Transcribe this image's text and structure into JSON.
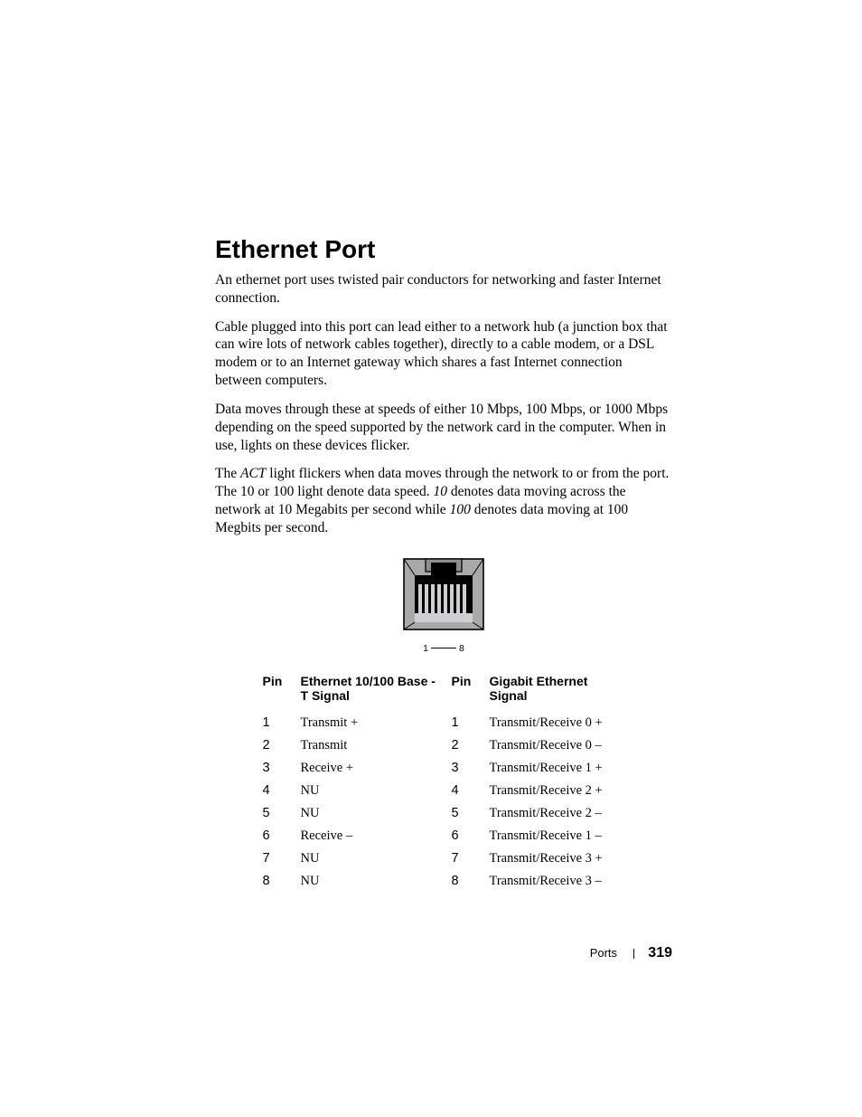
{
  "heading": "Ethernet Port",
  "para1": "An ethernet port uses twisted pair conductors for networking and faster Internet connection.",
  "para2": "Cable plugged into this port can lead either to a network hub (a junction box that can wire lots of network cables together), directly to a cable modem, or a DSL modem or to an Internet gateway which shares a fast Internet connection between computers.",
  "para3": "Data moves through these at speeds of either 10 Mbps, 100 Mbps, or 1000 Mbps depending on the speed supported by the network card in the computer. When in use, lights on these devices flicker.",
  "p4": {
    "a": "The ",
    "act": "ACT",
    "b": " light flickers when data moves through the network to or from the port. The 10 or 100 light denote data speed. ",
    "ten": "10",
    "c": " denotes data moving across the network at 10 Megabits per second while ",
    "hundred": "100",
    "d": " denotes data moving at 100 Megbits per second."
  },
  "caption": {
    "left": "1",
    "right": "8"
  },
  "headers": {
    "pin_a": "Pin",
    "signal_a": "Ethernet 10/100 Base - T Signal",
    "pin_b": "Pin",
    "signal_b": "Gigabit Ethernet Signal"
  },
  "rows": [
    {
      "pa": "1",
      "sa": "Transmit +",
      "pb": "1",
      "sb": "Transmit/Receive 0 +"
    },
    {
      "pa": "2",
      "sa": "Transmit",
      "pb": "2",
      "sb": "Transmit/Receive 0 –"
    },
    {
      "pa": "3",
      "sa": "Receive +",
      "pb": "3",
      "sb": "Transmit/Receive 1 +"
    },
    {
      "pa": "4",
      "sa": "NU",
      "pb": "4",
      "sb": "Transmit/Receive 2 +"
    },
    {
      "pa": "5",
      "sa": "NU",
      "pb": "5",
      "sb": "Transmit/Receive 2 –"
    },
    {
      "pa": "6",
      "sa": "Receive –",
      "pb": "6",
      "sb": "Transmit/Receive 1 –"
    },
    {
      "pa": "7",
      "sa": "NU",
      "pb": "7",
      "sb": "Transmit/Receive 3 +"
    },
    {
      "pa": "8",
      "sa": "NU",
      "pb": "8",
      "sb": "Transmit/Receive 3 –"
    }
  ],
  "footer": {
    "chapter": "Ports",
    "page": "319"
  }
}
